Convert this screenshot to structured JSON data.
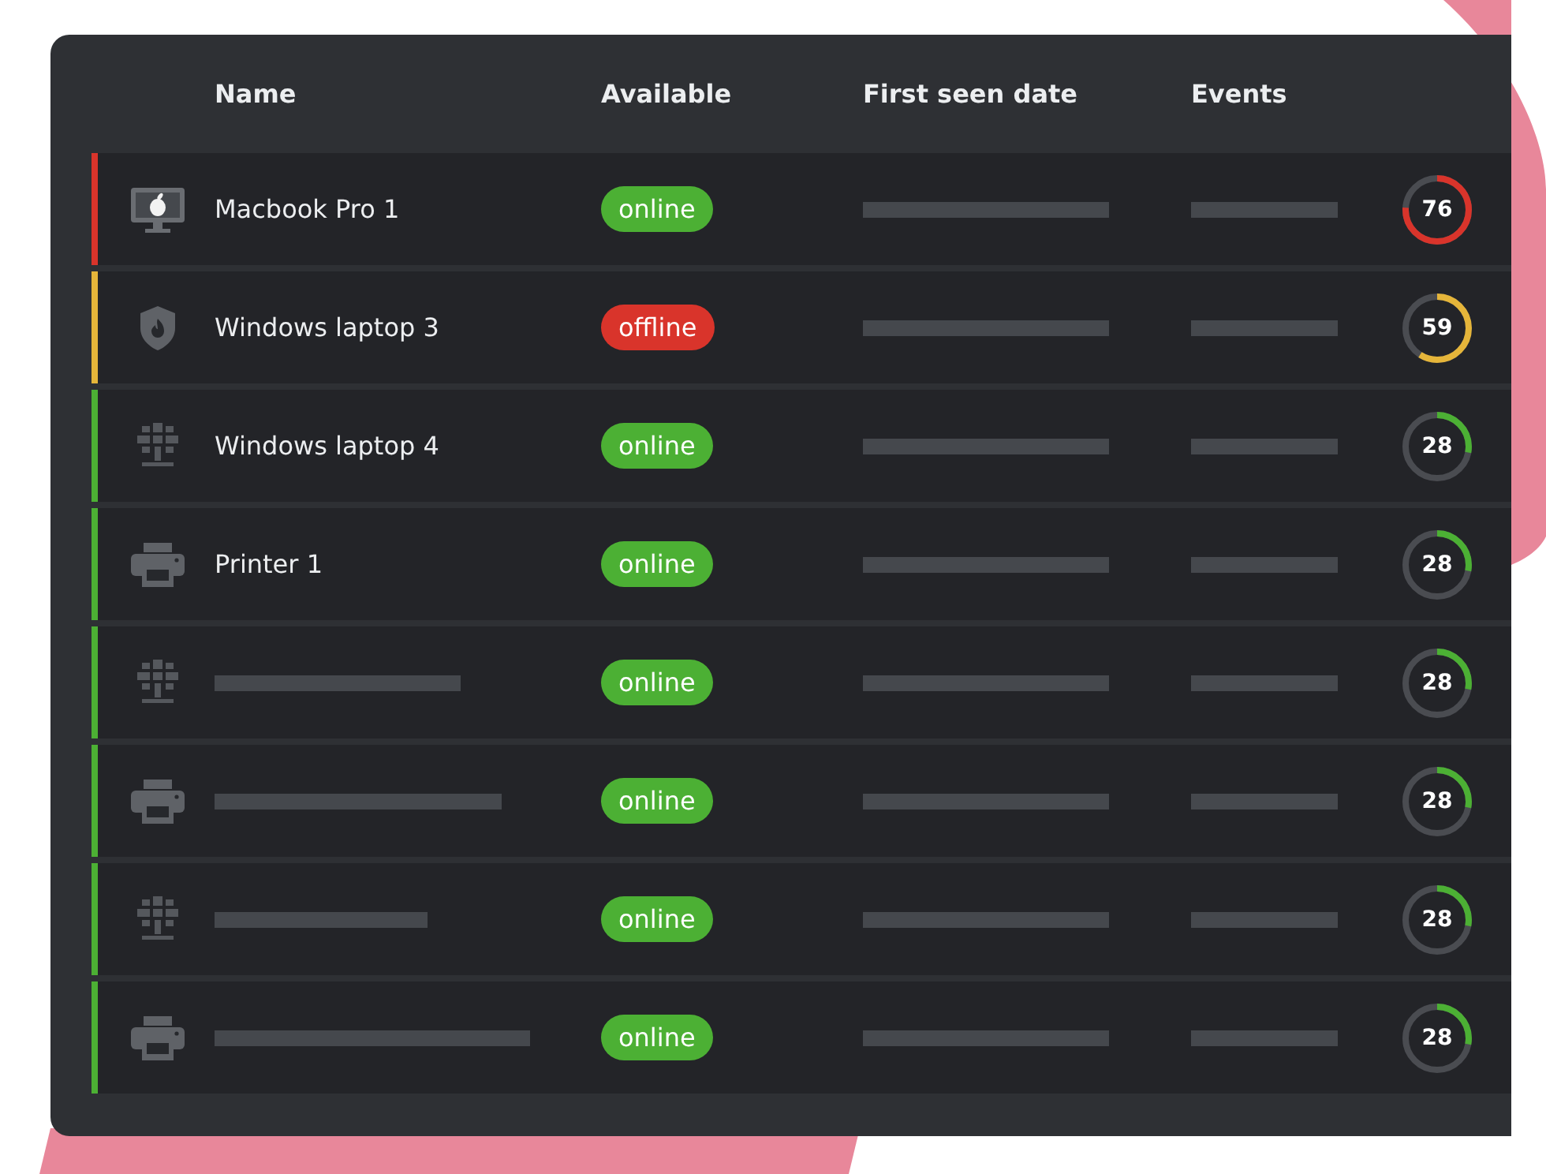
{
  "table": {
    "columns": [
      "Name",
      "Available",
      "First seen date",
      "Events"
    ],
    "rows": [
      {
        "kind": "monitor",
        "name": "Macbook Pro 1",
        "color": "#d9342b",
        "available": true,
        "status": "online",
        "score": "76",
        "level": 0.76
      },
      {
        "kind": "shield",
        "name": "Windows laptop 3",
        "color": "#e5b53a",
        "available": false,
        "status": "offline",
        "score": "59",
        "level": 0.59
      },
      {
        "kind": "globe",
        "name": "Windows laptop 4",
        "color": "#4cb034",
        "available": true,
        "status": "online",
        "score": "28",
        "level": 0.28
      },
      {
        "kind": "printer",
        "name": "Printer 1",
        "color": "#4cb034",
        "available": true,
        "status": "online",
        "score": "28",
        "level": 0.28
      },
      {
        "kind": "globe",
        "color": "#4cb034",
        "available": true,
        "status": "online",
        "score": "28",
        "level": 0.28
      },
      {
        "kind": "printer",
        "color": "#4cb034",
        "available": true,
        "status": "online",
        "score": "28",
        "level": 0.28
      },
      {
        "kind": "globe",
        "color": "#4cb034",
        "available": true,
        "status": "online",
        "score": "28",
        "level": 0.28
      },
      {
        "kind": "printer",
        "color": "#4cb034",
        "available": true,
        "status": "online",
        "score": "28",
        "level": 0.28
      }
    ]
  }
}
